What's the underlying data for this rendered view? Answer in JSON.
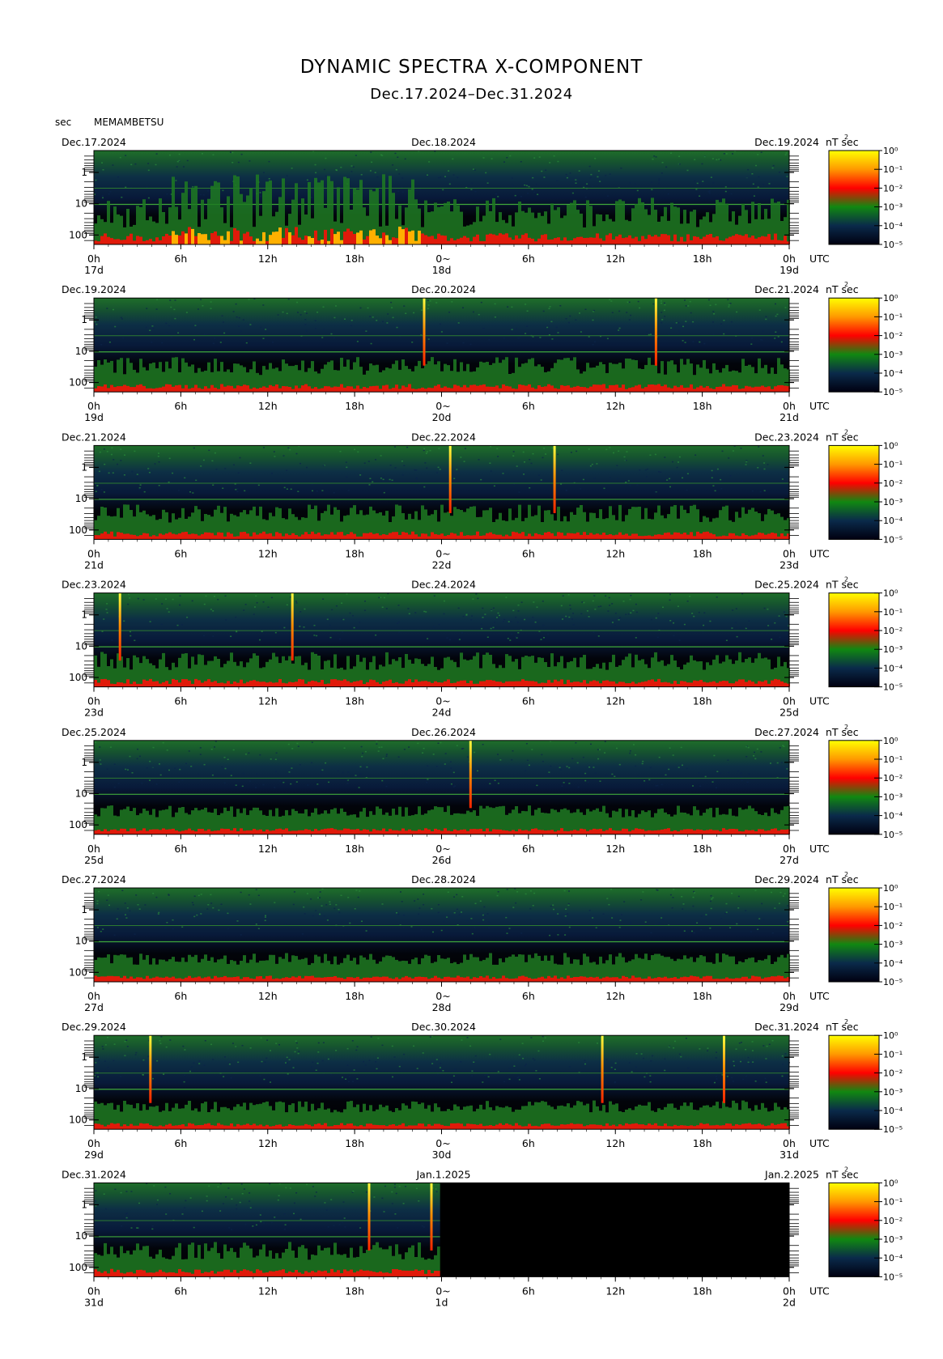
{
  "header": {
    "title": "DYNAMIC SPECTRA X-COMPONENT",
    "subtitle": "Dec.17.2024–Dec.31.2024",
    "unit_label": "sec",
    "station": "MEMAMBETSU"
  },
  "chart_data": {
    "type": "heatmap",
    "title": "DYNAMIC SPECTRA X-COMPONENT",
    "subtitle": "Dec.17.2024–Dec.31.2024",
    "ylabel": "sec",
    "y_scale": "log",
    "y_ticks": [
      "1",
      "10",
      "100"
    ],
    "x_ticks": [
      "0h",
      "6h",
      "12h",
      "18h",
      "0h",
      "6h",
      "12h",
      "18h",
      "0h"
    ],
    "x_unit": "UTC",
    "colorbar": {
      "label": "nT²sec",
      "ticks": [
        "10⁰",
        "10⁻¹",
        "10⁻²",
        "10⁻³",
        "10⁻⁴",
        "10⁻⁵"
      ],
      "colors": [
        "#ffff00",
        "#ff9900",
        "#ff0000",
        "#008800",
        "#06123a",
        "#000000"
      ]
    },
    "panels": [
      {
        "start_label": "Dec.17.2024",
        "mid_label": "Dec.18.2024",
        "end_label": "Dec.19.2024",
        "day_labels": [
          "17d",
          "18d",
          "19d"
        ],
        "spikes_hours": [],
        "activity": "high",
        "data_end_hours": 48
      },
      {
        "start_label": "Dec.19.2024",
        "mid_label": "Dec.20.2024",
        "end_label": "Dec.21.2024",
        "day_labels": [
          "19d",
          "20d",
          "21d"
        ],
        "spikes_hours": [
          22.8,
          38.8
        ],
        "activity": "medium",
        "data_end_hours": 48
      },
      {
        "start_label": "Dec.21.2024",
        "mid_label": "Dec.22.2024",
        "end_label": "Dec.23.2024",
        "day_labels": [
          "21d",
          "22d",
          "23d"
        ],
        "spikes_hours": [
          24.6,
          31.8
        ],
        "activity": "medium",
        "data_end_hours": 48
      },
      {
        "start_label": "Dec.23.2024",
        "mid_label": "Dec.24.2024",
        "end_label": "Dec.25.2024",
        "day_labels": [
          "23d",
          "24d",
          "25d"
        ],
        "spikes_hours": [
          1.8,
          13.7
        ],
        "activity": "medium",
        "data_end_hours": 48
      },
      {
        "start_label": "Dec.25.2024",
        "mid_label": "Dec.26.2024",
        "end_label": "Dec.27.2024",
        "day_labels": [
          "25d",
          "26d",
          "27d"
        ],
        "spikes_hours": [
          26.0
        ],
        "activity": "low",
        "data_end_hours": 48
      },
      {
        "start_label": "Dec.27.2024",
        "mid_label": "Dec.28.2024",
        "end_label": "Dec.29.2024",
        "day_labels": [
          "27d",
          "28d",
          "29d"
        ],
        "spikes_hours": [],
        "activity": "low",
        "data_end_hours": 48
      },
      {
        "start_label": "Dec.29.2024",
        "mid_label": "Dec.30.2024",
        "end_label": "Dec.31.2024",
        "day_labels": [
          "29d",
          "30d",
          "31d"
        ],
        "spikes_hours": [
          3.9,
          35.1,
          43.5
        ],
        "activity": "low",
        "data_end_hours": 48
      },
      {
        "start_label": "Dec.31.2024",
        "mid_label": "Jan.1.2025",
        "end_label": "Jan.2.2025",
        "day_labels": [
          "31d",
          "1d",
          "2d"
        ],
        "spikes_hours": [
          19.0,
          23.3
        ],
        "activity": "medium",
        "data_end_hours": 23.9
      }
    ]
  }
}
